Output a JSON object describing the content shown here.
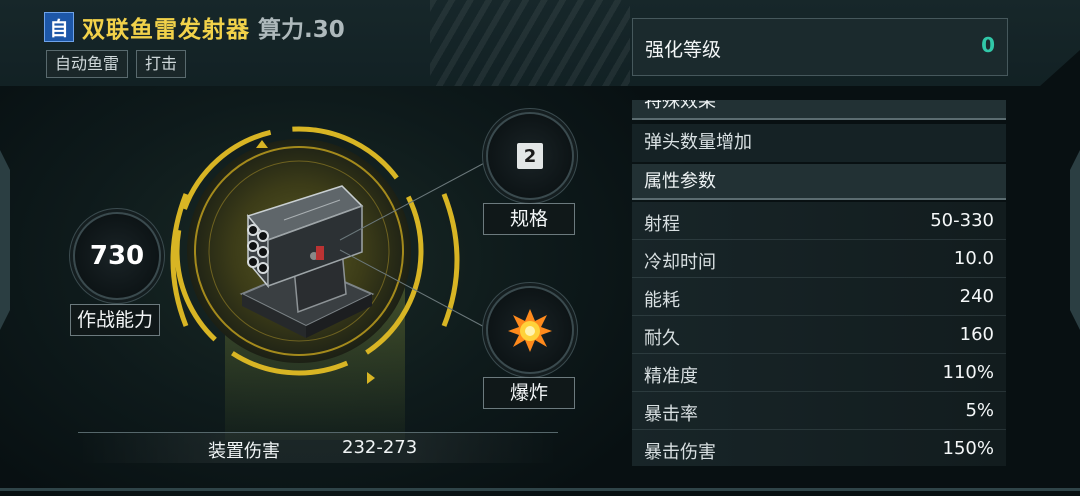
{
  "header": {
    "badge": "自",
    "title": "双联鱼雷发射器",
    "compute": "算力.30",
    "tags": [
      "自动鱼雷",
      "打击"
    ]
  },
  "stats": {
    "combat_value": "730",
    "combat_label": "作战能力",
    "spec_value": "2",
    "spec_label": "规格",
    "type_label": "爆炸"
  },
  "damage": {
    "label": "装置伤害",
    "value": "232-273"
  },
  "upgrade": {
    "label": "强化等级",
    "value": "0"
  },
  "panel": {
    "special_header": "特殊效果",
    "special_text": "弹头数量增加",
    "attr_header": "属性参数",
    "attributes": [
      {
        "name": "射程",
        "value": "50-330"
      },
      {
        "name": "冷却时间",
        "value": "10.0"
      },
      {
        "name": "能耗",
        "value": "240"
      },
      {
        "name": "耐久",
        "value": "160"
      },
      {
        "name": "精准度",
        "value": "110%"
      },
      {
        "name": "暴击率",
        "value": "5%"
      },
      {
        "name": "暴击伤害",
        "value": "150%"
      }
    ]
  },
  "colors": {
    "title": "#f2d24a",
    "badge": "#1d57a8",
    "upgrade_value": "#31c8a8",
    "ring": "#d8b524"
  },
  "icons": [
    "explosion-icon",
    "torpedo-launcher-image"
  ]
}
